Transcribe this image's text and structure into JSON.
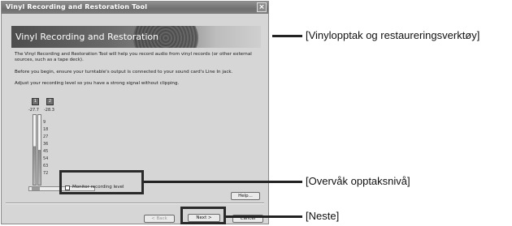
{
  "window": {
    "title": "Vinyl Recording and Restoration Tool",
    "close_glyph": "×"
  },
  "banner": {
    "title": "Vinyl Recording and Restoration"
  },
  "body_text": {
    "intro": "The Vinyl Recording and Restoration Tool will help you record audio from vinyl records (or other external sources, such as a tape deck).",
    "begin": "Before you begin, ensure your turntable's output is connected to your sound card's Line In jack.",
    "adjust": "Adjust your recording level so you have a strong signal without clipping."
  },
  "meter": {
    "channels": [
      "1",
      "2"
    ],
    "peaks": [
      "-27.7",
      "-28.3"
    ],
    "ticks": [
      "9",
      "18",
      "27",
      "36",
      "45",
      "54",
      "63",
      "72"
    ],
    "levels": [
      0.55,
      0.5
    ]
  },
  "controls": {
    "monitor_label": "Monitor recording level",
    "help_label": "Help...",
    "back_label": "< Back",
    "next_label": "Next >",
    "cancel_label": "Cancel"
  },
  "callouts": {
    "title": "[Vinylopptak og restaureringsverktøy]",
    "monitor": "[Overvåk opptaksnivå]",
    "next": "[Neste]"
  }
}
